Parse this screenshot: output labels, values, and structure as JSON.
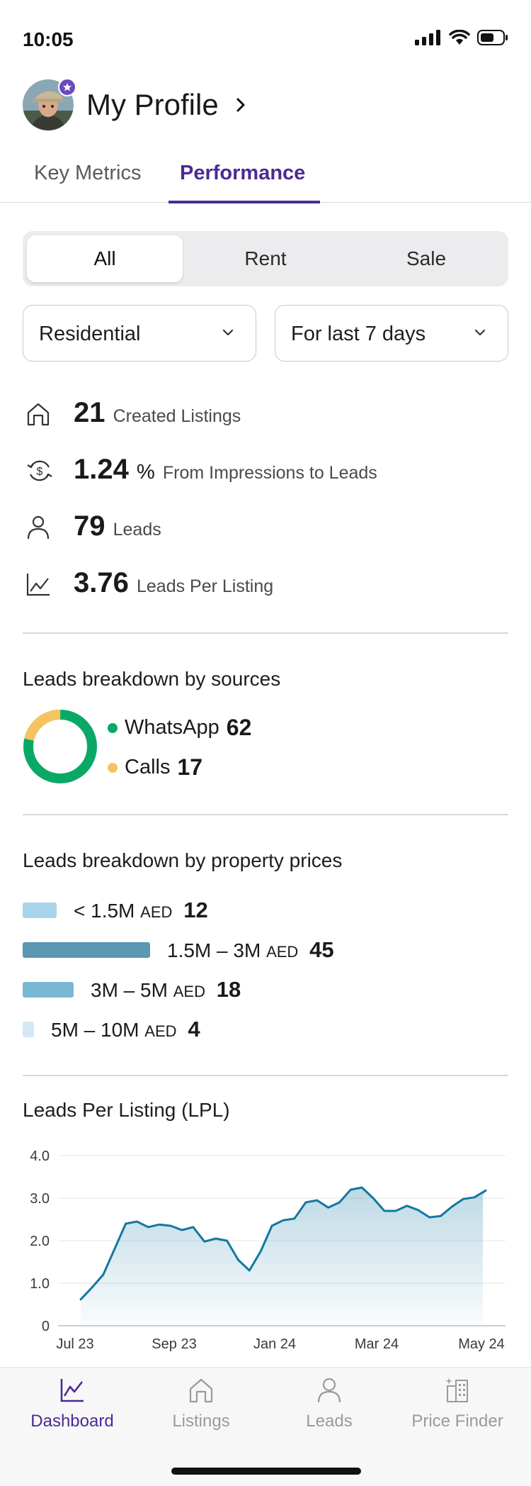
{
  "status_bar": {
    "time": "10:05"
  },
  "profile": {
    "title": "My Profile"
  },
  "top_tabs": [
    {
      "label": "Key Metrics",
      "active": false
    },
    {
      "label": "Performance",
      "active": true
    }
  ],
  "segments": [
    {
      "label": "All",
      "active": true
    },
    {
      "label": "Rent",
      "active": false
    },
    {
      "label": "Sale",
      "active": false
    }
  ],
  "filters": {
    "property_type": "Residential",
    "period": "For last 7 days"
  },
  "metrics": [
    {
      "icon": "house-icon",
      "value": "21",
      "unit": "",
      "label": "Created Listings"
    },
    {
      "icon": "refresh-dollar-icon",
      "value": "1.24",
      "unit": "%",
      "label": "From Impressions to Leads"
    },
    {
      "icon": "person-icon",
      "value": "79",
      "unit": "",
      "label": "Leads"
    },
    {
      "icon": "line-chart-icon",
      "value": "3.76",
      "unit": "",
      "label": "Leads Per Listing"
    }
  ],
  "sources": {
    "title": "Leads breakdown by sources",
    "items": [
      {
        "name": "WhatsApp",
        "count": "62",
        "color": "#0aa866"
      },
      {
        "name": "Calls",
        "count": "17",
        "color": "#f5c45e"
      }
    ]
  },
  "prices": {
    "title": "Leads breakdown by property prices",
    "currency": "AED",
    "items": [
      {
        "range": "< 1.5M",
        "count": "12",
        "color": "#a9d3ea"
      },
      {
        "range": "1.5M – 3M",
        "count": "45",
        "color": "#5b97b0"
      },
      {
        "range": "3M – 5M",
        "count": "18",
        "color": "#7ab8d6"
      },
      {
        "range": "5M – 10M",
        "count": "4",
        "color": "#d3e8f5"
      }
    ]
  },
  "lpl": {
    "title": "Leads Per Listing (LPL)"
  },
  "chart_data": {
    "type": "area",
    "title": "Leads Per Listing (LPL)",
    "xlabel": "",
    "ylabel": "",
    "ylim": [
      0,
      4.0
    ],
    "yticks": [
      "0",
      "1.0",
      "2.0",
      "3.0",
      "4.0"
    ],
    "xticks": [
      "Jul 23",
      "Sep 23",
      "Jan 24",
      "Mar 24",
      "May 24"
    ],
    "grid": true,
    "series": [
      {
        "color": "#1478a0",
        "points": [
          [
            0,
            0.62
          ],
          [
            1,
            0.9
          ],
          [
            2,
            1.2
          ],
          [
            3,
            1.8
          ],
          [
            4,
            2.4
          ],
          [
            5,
            2.45
          ],
          [
            6,
            2.32
          ],
          [
            7,
            2.38
          ],
          [
            8,
            2.35
          ],
          [
            9,
            2.25
          ],
          [
            10,
            2.32
          ],
          [
            11,
            1.98
          ],
          [
            12,
            2.05
          ],
          [
            13,
            2.0
          ],
          [
            14,
            1.55
          ],
          [
            15,
            1.3
          ],
          [
            16,
            1.75
          ],
          [
            17,
            2.35
          ],
          [
            18,
            2.48
          ],
          [
            19,
            2.52
          ],
          [
            20,
            2.9
          ],
          [
            21,
            2.95
          ],
          [
            22,
            2.78
          ],
          [
            23,
            2.9
          ],
          [
            24,
            3.2
          ],
          [
            25,
            3.25
          ],
          [
            26,
            3.0
          ],
          [
            27,
            2.7
          ],
          [
            28,
            2.7
          ],
          [
            29,
            2.82
          ],
          [
            30,
            2.72
          ],
          [
            31,
            2.55
          ],
          [
            32,
            2.58
          ],
          [
            33,
            2.8
          ],
          [
            34,
            2.98
          ],
          [
            35,
            3.02
          ],
          [
            36,
            3.18
          ]
        ]
      }
    ]
  },
  "bottom_nav": [
    {
      "icon": "dashboard-icon",
      "label": "Dashboard",
      "active": true
    },
    {
      "icon": "listings-icon",
      "label": "Listings",
      "active": false
    },
    {
      "icon": "leads-icon",
      "label": "Leads",
      "active": false
    },
    {
      "icon": "price-finder-icon",
      "label": "Price Finder",
      "active": false
    }
  ]
}
